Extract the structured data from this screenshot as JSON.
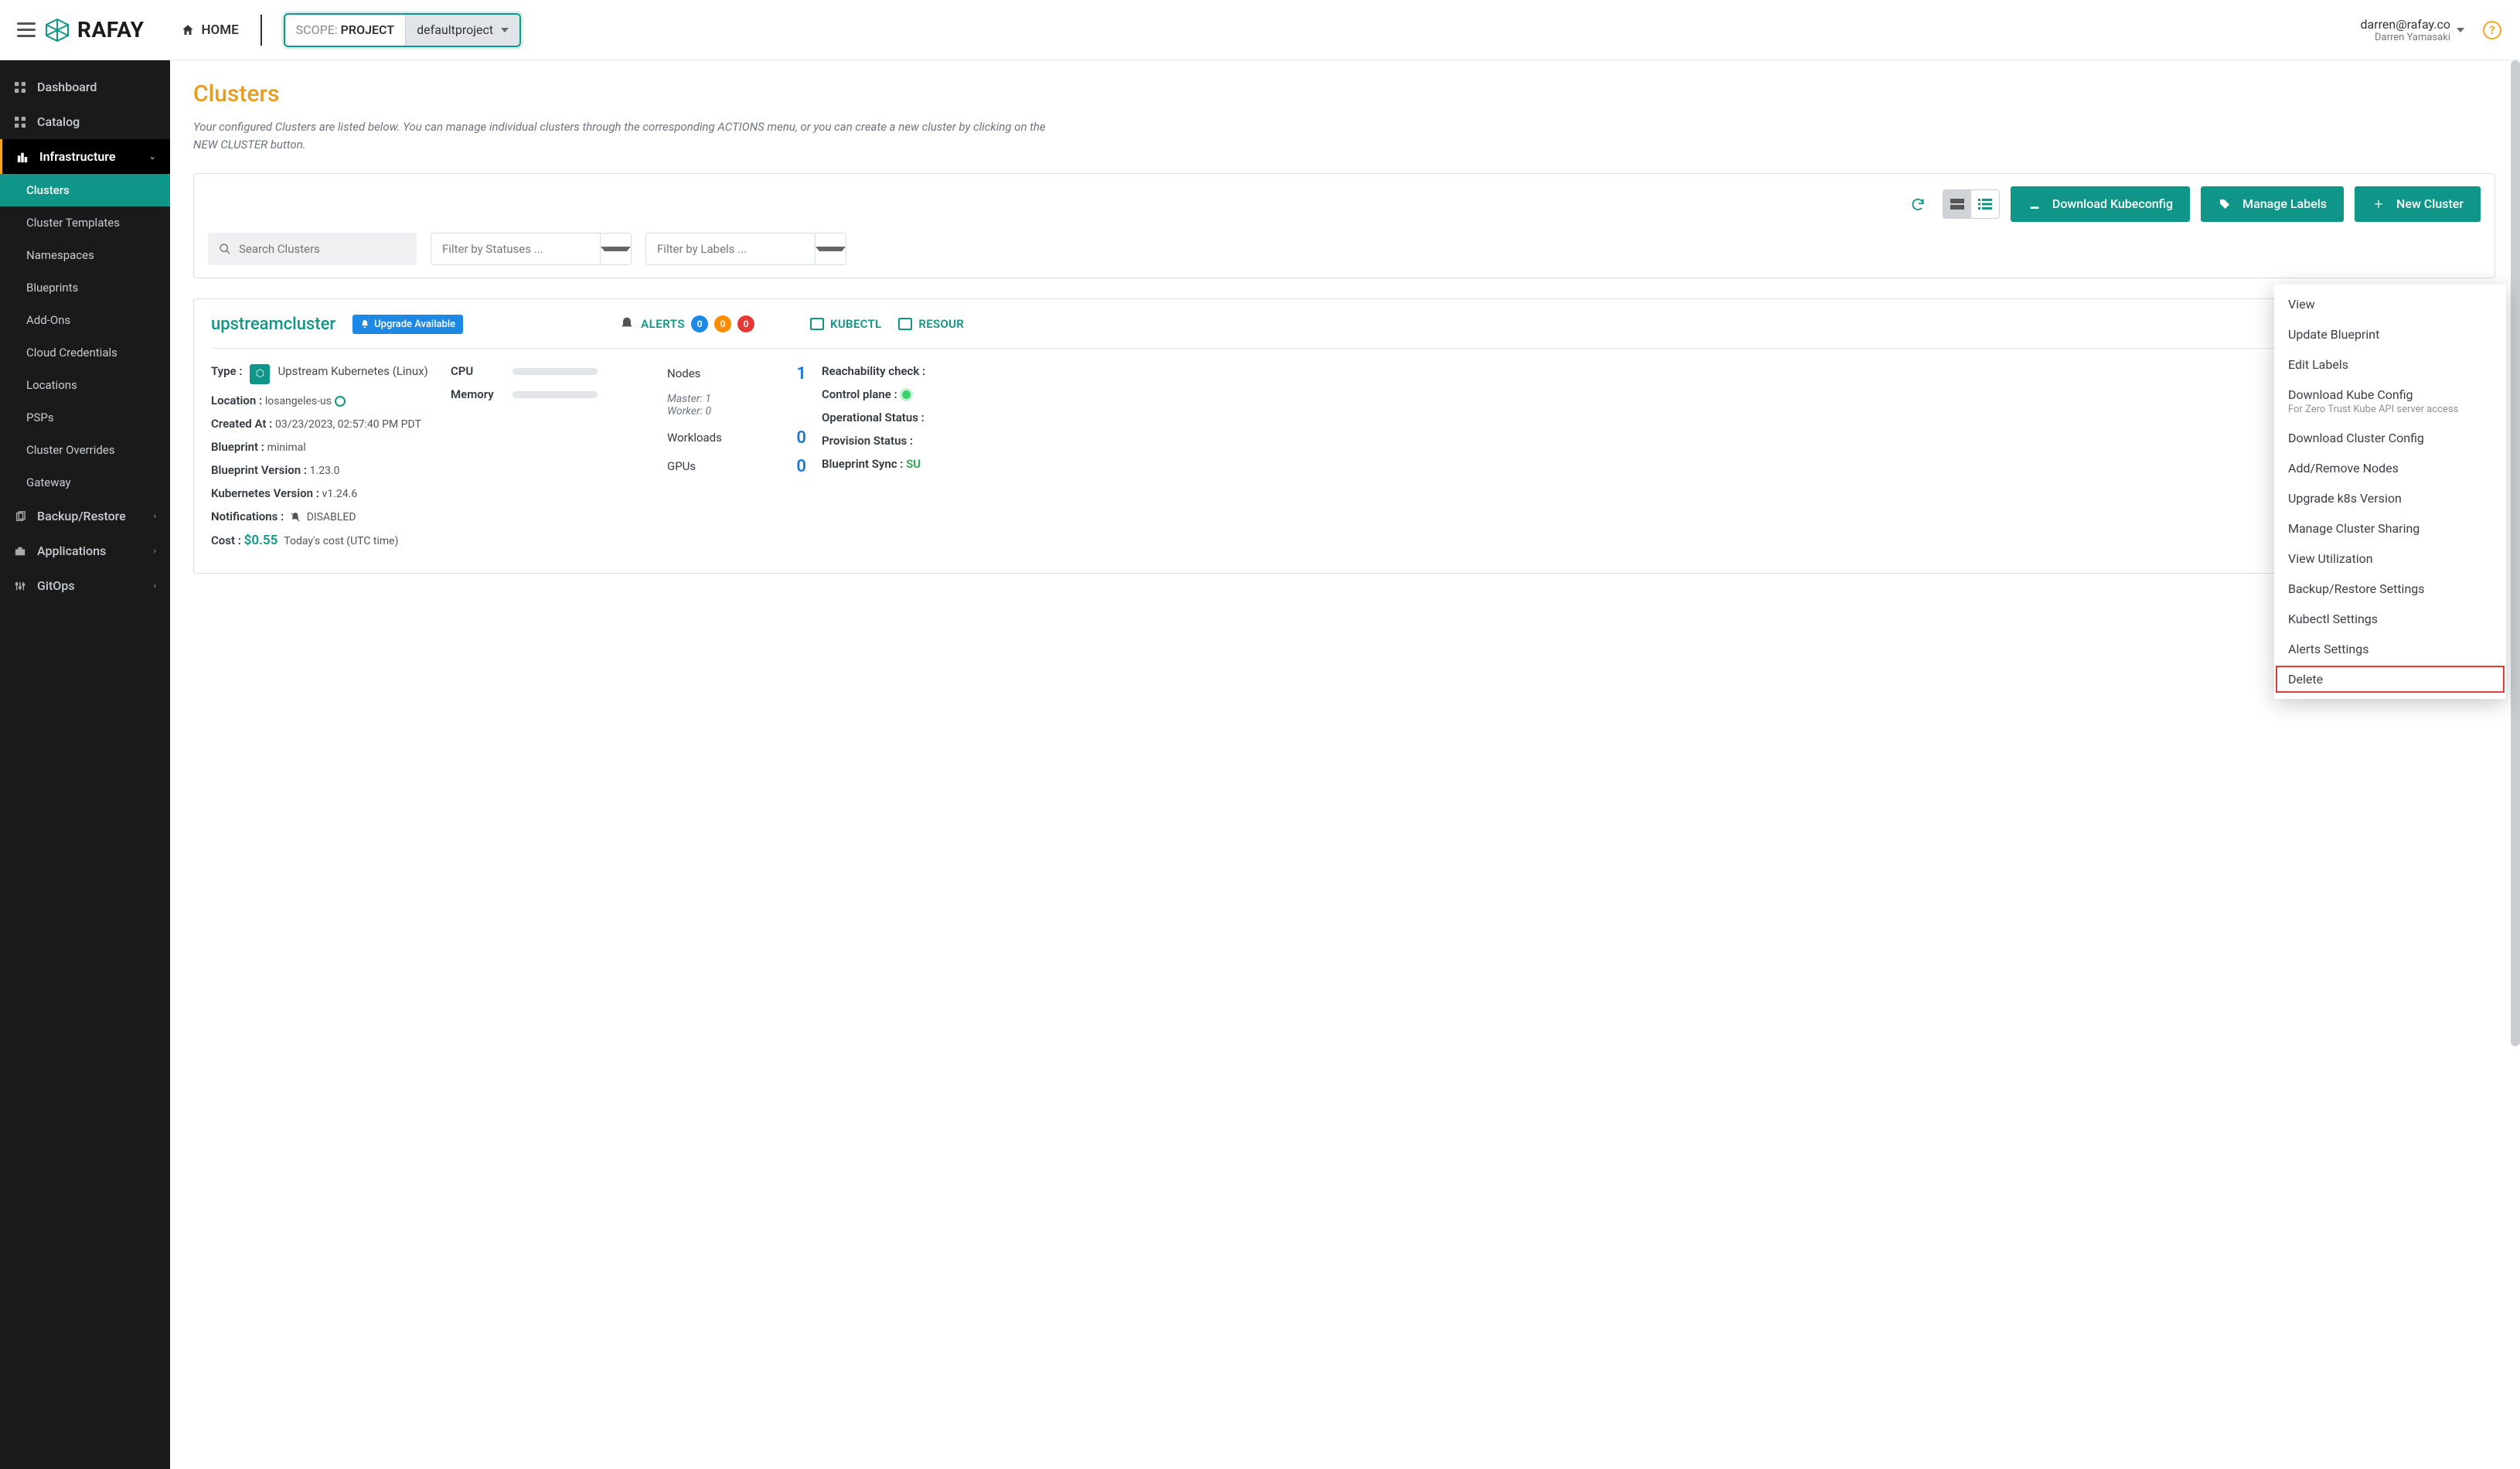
{
  "header": {
    "home_label": "HOME",
    "scope_prefix": "SCOPE:",
    "scope_value": "PROJECT",
    "scope_project": "defaultproject",
    "user_email": "darren@rafay.co",
    "user_name": "Darren Yamasaki",
    "logo_text": "RAFAY"
  },
  "sidebar": {
    "items": [
      {
        "label": "Dashboard",
        "icon": "grid"
      },
      {
        "label": "Catalog",
        "icon": "grid"
      },
      {
        "label": "Infrastructure",
        "icon": "city",
        "active_section": true,
        "expanded": true,
        "children": [
          {
            "label": "Clusters",
            "active": true
          },
          {
            "label": "Cluster Templates"
          },
          {
            "label": "Namespaces"
          },
          {
            "label": "Blueprints"
          },
          {
            "label": "Add-Ons"
          },
          {
            "label": "Cloud Credentials"
          },
          {
            "label": "Locations"
          },
          {
            "label": "PSPs"
          },
          {
            "label": "Cluster Overrides"
          },
          {
            "label": "Gateway"
          }
        ]
      },
      {
        "label": "Backup/Restore",
        "icon": "copy",
        "chev": true
      },
      {
        "label": "Applications",
        "icon": "briefcase",
        "chev": true
      },
      {
        "label": "GitOps",
        "icon": "sliders",
        "chev": true
      }
    ]
  },
  "page": {
    "title": "Clusters",
    "description": "Your configured Clusters are listed below. You can manage individual clusters through the corresponding ACTIONS menu, or you can create a new cluster by clicking on the NEW CLUSTER button."
  },
  "toolbar": {
    "search_placeholder": "Search Clusters",
    "filter_status_placeholder": "Filter by Statuses ...",
    "filter_labels_placeholder": "Filter by Labels ...",
    "download_kubeconfig": "Download Kubeconfig",
    "manage_labels": "Manage Labels",
    "new_cluster": "New Cluster"
  },
  "cluster": {
    "name": "upstreamcluster",
    "upgrade_badge": "Upgrade Available",
    "alerts_label": "ALERTS",
    "alerts": {
      "info": "0",
      "warn": "0",
      "crit": "0"
    },
    "kubectl_label": "KUBECTL",
    "resources_label": "RESOUR",
    "type_label": "Type :",
    "type_value": "Upstream Kubernetes (Linux)",
    "location_label": "Location :",
    "location_value": "losangeles-us",
    "created_label": "Created At :",
    "created_value": "03/23/2023, 02:57:40 PM PDT",
    "blueprint_label": "Blueprint :",
    "blueprint_value": "minimal",
    "bpver_label": "Blueprint Version :",
    "bpver_value": "1.23.0",
    "k8sver_label": "Kubernetes Version :",
    "k8sver_value": "v1.24.6",
    "notif_label": "Notifications :",
    "notif_value": "DISABLED",
    "cost_label": "Cost :",
    "cost_value": "$0.55",
    "cost_note": "Today's cost (UTC time)",
    "cpu_label": "CPU",
    "mem_label": "Memory",
    "cpu_pct": 12,
    "mem_pct": 4,
    "nodes_label": "Nodes",
    "nodes_value": "1",
    "master_label": "Master: 1",
    "worker_label": "Worker: 0",
    "workloads_label": "Workloads",
    "workloads_value": "0",
    "gpus_label": "GPUs",
    "gpus_value": "0",
    "reach_label": "Reachability check :",
    "cp_label": "Control plane :",
    "op_label": "Operational Status :",
    "prov_label": "Provision Status :",
    "bpsync_label": "Blueprint Sync :",
    "bpsync_value": "SU"
  },
  "context_menu": {
    "items": [
      {
        "label": "View"
      },
      {
        "label": "Update Blueprint"
      },
      {
        "label": "Edit Labels"
      },
      {
        "label": "Download Kube Config",
        "sub": "For Zero Trust Kube API server access"
      },
      {
        "label": "Download Cluster Config"
      },
      {
        "label": "Add/Remove Nodes"
      },
      {
        "label": "Upgrade k8s Version"
      },
      {
        "label": "Manage Cluster Sharing"
      },
      {
        "label": "View Utilization"
      },
      {
        "label": "Backup/Restore Settings"
      },
      {
        "label": "Kubectl Settings"
      },
      {
        "label": "Alerts Settings"
      },
      {
        "label": "Delete",
        "highlight": true
      }
    ]
  }
}
